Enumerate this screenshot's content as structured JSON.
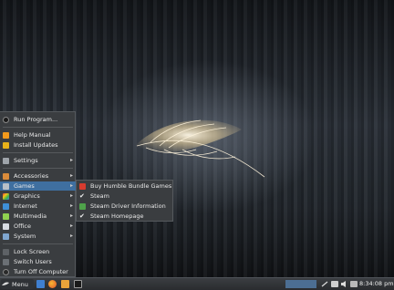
{
  "menu": {
    "items": [
      {
        "label": "Run Program...",
        "icon": "run-icon"
      },
      {
        "label": "Help Manual",
        "icon": "help-icon"
      },
      {
        "label": "Install Updates",
        "icon": "updates-icon"
      },
      {
        "label": "Settings",
        "icon": "settings-icon"
      },
      {
        "label": "Accessories",
        "icon": "accessories-icon"
      },
      {
        "label": "Games",
        "icon": "games-icon"
      },
      {
        "label": "Graphics",
        "icon": "graphics-icon"
      },
      {
        "label": "Internet",
        "icon": "internet-icon"
      },
      {
        "label": "Multimedia",
        "icon": "multimedia-icon"
      },
      {
        "label": "Office",
        "icon": "office-icon"
      },
      {
        "label": "System",
        "icon": "system-icon"
      },
      {
        "label": "Lock Screen",
        "icon": "lock-icon"
      },
      {
        "label": "Switch Users",
        "icon": "switch-users-icon"
      },
      {
        "label": "Turn Off Computer",
        "icon": "power-icon"
      }
    ],
    "submenu_arrow": "▸"
  },
  "games_submenu": [
    {
      "label": "Buy Humble Bundle Games",
      "icon": "humble-bundle-icon"
    },
    {
      "label": "Steam",
      "icon": "steam-icon"
    },
    {
      "label": "Steam Driver Information",
      "icon": "steam-driver-icon"
    },
    {
      "label": "Steam Homepage",
      "icon": "steam-homepage-icon"
    }
  ],
  "taskbar": {
    "menu_label": "Menu",
    "clock": "8:34:08 pm",
    "launchers": [
      "file-manager-icon",
      "firefox-icon",
      "software-center-icon",
      "terminal-icon"
    ]
  },
  "colors": {
    "highlight": "#3f6fa0",
    "menu_bg": "#3a3d40",
    "workspace": "#4c6e93"
  }
}
